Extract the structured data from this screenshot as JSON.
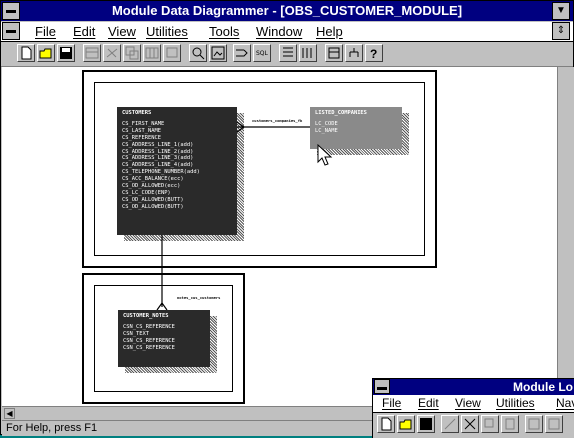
{
  "window": {
    "title": "Module Data Diagrammer - [OBS_CUSTOMER_MODULE]"
  },
  "menu": {
    "items": [
      "File",
      "Edit",
      "View",
      "Utilities",
      "Tools",
      "Window",
      "Help"
    ]
  },
  "toolbar": {
    "buttons": [
      "new-icon",
      "open-icon",
      "save-icon",
      "table-icon",
      "link-icon",
      "copy-icon",
      "grid-icon",
      "screen-icon",
      "zoom-icon",
      "image-icon",
      "connect-icon",
      "sql-icon",
      "align-icon",
      "align2-icon",
      "layout-icon",
      "tree-icon",
      "help-icon"
    ],
    "sql_label": "SQL",
    "help_label": "?"
  },
  "diagram": {
    "customers": {
      "name": "CUSTOMERS",
      "columns": [
        "CS_FIRST_NAME",
        "CS_LAST_NAME",
        "CS_REFERENCE",
        "CS_ADDRESS_LINE_1(add)",
        "CS_ADDRESS_LINE_2(add)",
        "CS_ADDRESS_LINE_3(add)",
        "CS_ADDRESS_LINE_4(add)",
        "CS_TELEPHONE_NUMBER(add)",
        "CS_ACC_BALANCE(ecc)",
        "CS_OD_ALLOWED(ecc)",
        "CS_LC_CODE(ENP)",
        "CS_OD_ALLOWED(BUTT)",
        "CS_OD_ALLOWED(BUTT)"
      ]
    },
    "listed_companies": {
      "name": "LISTED_COMPANIES",
      "columns": [
        "LC_CODE",
        "LC_NAME"
      ]
    },
    "customer_notes": {
      "name": "CUSTOMER_NOTES",
      "columns": [
        "CSN_CS_REFERENCE",
        "CSN_TEXT",
        "CSN_CS_REFERENCE",
        "CSN_CS_REFERENCE"
      ]
    },
    "relationship_labels": {
      "customers_listed": "customers_companies_fk",
      "notes_customers": "notes_cus_customers"
    }
  },
  "status": {
    "text": "For Help, press F1"
  },
  "second_window": {
    "title": "Module Lo",
    "menu": [
      "File",
      "Edit",
      "View",
      "Utilities",
      "Nav"
    ]
  }
}
